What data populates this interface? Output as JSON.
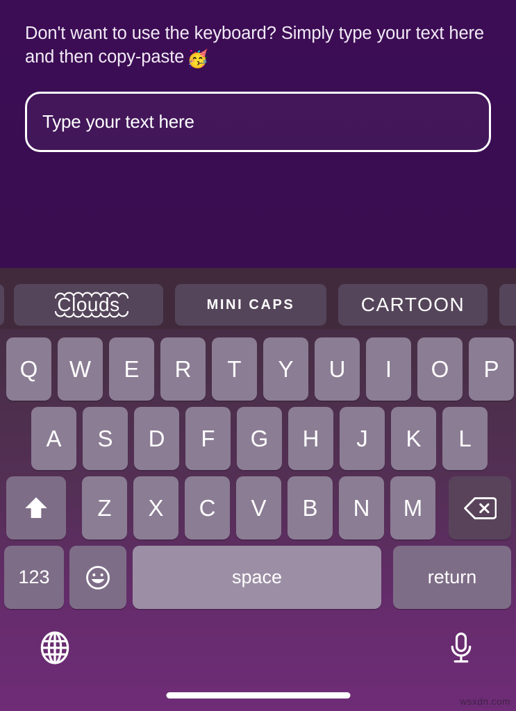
{
  "app": {
    "prompt_text": "Don't want to use the keyboard? Simply type your text here and then copy-paste",
    "prompt_emoji": "🥳",
    "input_placeholder": "Type your text here",
    "input_value": ""
  },
  "keyboard": {
    "suggestions": [
      {
        "label": "Clouds",
        "style": "clouds"
      },
      {
        "label": "MINI CAPS",
        "style": "mini-caps"
      },
      {
        "label": "CARTOON",
        "style": "cartoon"
      }
    ],
    "row1": [
      "Q",
      "W",
      "E",
      "R",
      "T",
      "Y",
      "U",
      "I",
      "O",
      "P"
    ],
    "row2": [
      "A",
      "S",
      "D",
      "F",
      "G",
      "H",
      "J",
      "K",
      "L"
    ],
    "row3_letters": [
      "Z",
      "X",
      "C",
      "V",
      "B",
      "N",
      "M"
    ],
    "shift_icon": "shift-arrow-icon",
    "backspace_icon": "backspace-icon",
    "numeric_label": "123",
    "emoji_icon": "smiley-face-icon",
    "space_label": "space",
    "return_label": "return",
    "globe_icon": "globe-icon",
    "mic_icon": "microphone-icon"
  },
  "colors": {
    "app_background": "#3c0d55",
    "keyboard_top": "#43293f",
    "keyboard_bottom": "#6f2c77",
    "suggestion_strip": "#402a3c",
    "chip": "#55455a",
    "key": "#8b7d94",
    "key_dark": "#7e6d87",
    "key_darker": "#59435b",
    "key_space": "#9c8fa5",
    "text": "#ffffff"
  },
  "watermark": {
    "text": "wsxdn.com"
  }
}
